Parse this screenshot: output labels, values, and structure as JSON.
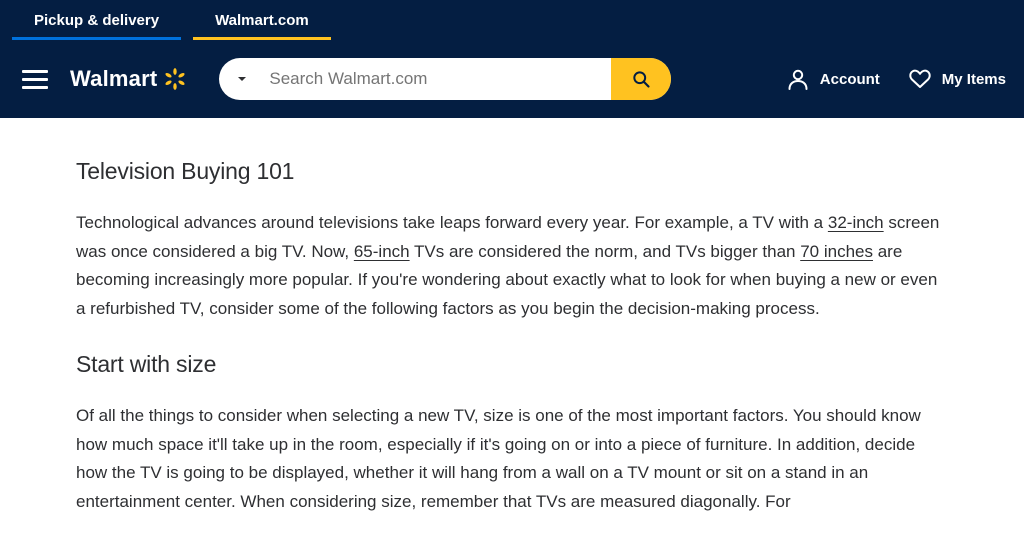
{
  "tabs": {
    "pickup": "Pickup & delivery",
    "dotcom": "Walmart.com"
  },
  "header": {
    "brand": "Walmart",
    "search_placeholder": "Search Walmart.com",
    "account": "Account",
    "myitems": "My Items"
  },
  "article": {
    "h1": "Television Buying 101",
    "p1a": "Technological advances around televisions take leaps forward every year. For example, a TV with a ",
    "link1": "32-inch",
    "p1b": " screen was once considered a big TV. Now, ",
    "link2": "65-inch",
    "p1c": " TVs are considered the norm, and TVs bigger than ",
    "link3": "70 inches",
    "p1d": " are becoming increasingly more popular. If you're wondering about exactly what to look for when buying a new or even a refurbished TV, consider some of the following factors as you begin the decision-making process.",
    "h2": "Start with size",
    "p2": "Of all the things to consider when selecting a new TV, size is one of the most important factors. You should know how much space it'll take up in the room, especially if it's going on or into a piece of furniture. In addition, decide how the TV is going to be displayed, whether it will hang from a wall on a TV mount or sit on a stand in an entertainment center. When considering size, remember that TVs are measured diagonally. For"
  }
}
